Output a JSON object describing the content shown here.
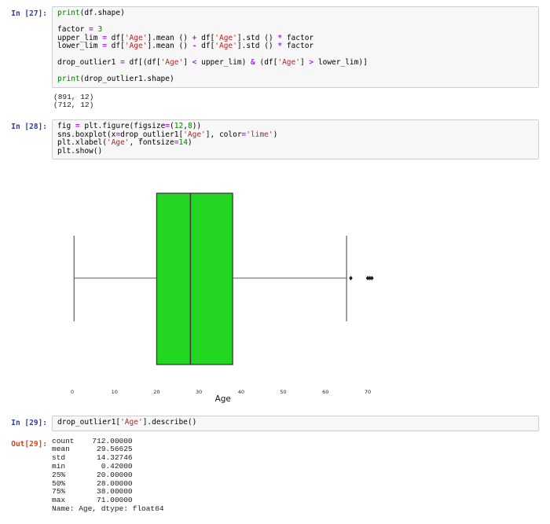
{
  "notebook": {
    "cells": [
      {
        "prompt": "In [27]:",
        "code_lines": [
          [
            [
              "b",
              "print"
            ],
            [
              "v",
              "(df.shape)"
            ]
          ],
          [],
          [
            [
              "v",
              "factor "
            ],
            [
              "o",
              "="
            ],
            [
              "v",
              " "
            ],
            [
              "n",
              "3"
            ]
          ],
          [
            [
              "v",
              "upper_lim "
            ],
            [
              "o",
              "="
            ],
            [
              "v",
              " df["
            ],
            [
              "s",
              "'Age'"
            ],
            [
              "v",
              "].mean () "
            ],
            [
              "o",
              "+"
            ],
            [
              "v",
              " df["
            ],
            [
              "s",
              "'Age'"
            ],
            [
              "v",
              "].std () "
            ],
            [
              "o",
              "*"
            ],
            [
              "v",
              " factor"
            ]
          ],
          [
            [
              "v",
              "lower_lim "
            ],
            [
              "o",
              "="
            ],
            [
              "v",
              " df["
            ],
            [
              "s",
              "'Age'"
            ],
            [
              "v",
              "].mean () "
            ],
            [
              "o",
              "-"
            ],
            [
              "v",
              " df["
            ],
            [
              "s",
              "'Age'"
            ],
            [
              "v",
              "].std () "
            ],
            [
              "o",
              "*"
            ],
            [
              "v",
              " factor"
            ]
          ],
          [],
          [
            [
              "v",
              "drop_outlier1 "
            ],
            [
              "o",
              "="
            ],
            [
              "v",
              " df[(df["
            ],
            [
              "s",
              "'Age'"
            ],
            [
              "v",
              "] "
            ],
            [
              "o",
              "<"
            ],
            [
              "v",
              " upper_lim) "
            ],
            [
              "o",
              "&"
            ],
            [
              "v",
              " (df["
            ],
            [
              "s",
              "'Age'"
            ],
            [
              "v",
              "] "
            ],
            [
              "o",
              ">"
            ],
            [
              "v",
              " lower_lim)]"
            ]
          ],
          [],
          [
            [
              "b",
              "print"
            ],
            [
              "v",
              "(drop_outlier1.shape)"
            ]
          ]
        ],
        "output_lines": [
          "(891, 12)",
          "(712, 12)"
        ]
      },
      {
        "prompt": "In [28]:",
        "code_lines": [
          [
            [
              "v",
              "fig "
            ],
            [
              "o",
              "="
            ],
            [
              "v",
              " plt.figure(figsize"
            ],
            [
              "o",
              "="
            ],
            [
              "v",
              "("
            ],
            [
              "n",
              "12"
            ],
            [
              "v",
              ","
            ],
            [
              "n",
              "8"
            ],
            [
              "v",
              "))"
            ]
          ],
          [
            [
              "v",
              "sns.boxplot(x"
            ],
            [
              "o",
              "="
            ],
            [
              "v",
              "drop_outlier1["
            ],
            [
              "s",
              "'Age'"
            ],
            [
              "v",
              "], color"
            ],
            [
              "o",
              "="
            ],
            [
              "s",
              "'lime'"
            ],
            [
              "v",
              ")"
            ]
          ],
          [
            [
              "v",
              "plt.xlabel("
            ],
            [
              "s",
              "'Age'"
            ],
            [
              "v",
              ", fontsize"
            ],
            [
              "o",
              "="
            ],
            [
              "n",
              "14"
            ],
            [
              "v",
              ")"
            ]
          ],
          [
            [
              "v",
              "plt.show()"
            ]
          ]
        ],
        "output_lines": []
      },
      {
        "prompt": "In [29]:",
        "code_lines": [
          [
            [
              "v",
              "drop_outlier1["
            ],
            [
              "s",
              "'Age'"
            ],
            [
              "v",
              "].describe()"
            ]
          ]
        ],
        "out_prompt": "Out[29]:",
        "output_lines": [
          "count    712.00000",
          "mean      29.56625",
          "std       14.32746",
          "min        0.42000",
          "25%       20.00000",
          "50%       28.00000",
          "75%       38.00000",
          "max       71.00000",
          "Name: Age, dtype: float64"
        ]
      }
    ]
  },
  "chart_data": {
    "type": "boxplot",
    "orientation": "horizontal",
    "title": "",
    "xlabel": "Age",
    "x_ticks": [
      0,
      10,
      20,
      30,
      40,
      50,
      60,
      70
    ],
    "xlim": [
      -3.1,
      74.5
    ],
    "grid": false,
    "box": {
      "q1": 20,
      "median": 28,
      "q3": 38,
      "whisker_low": 0.42,
      "whisker_high": 65,
      "fliers": [
        66,
        70,
        70.5,
        71
      ]
    },
    "style": {
      "box_fill": "#22d622",
      "box_edge": "#3a3a3a",
      "line_color": "#5a5a5a",
      "flier_color": "#1a1a1a",
      "tick_color": "#262626",
      "label_color": "#111111"
    }
  }
}
